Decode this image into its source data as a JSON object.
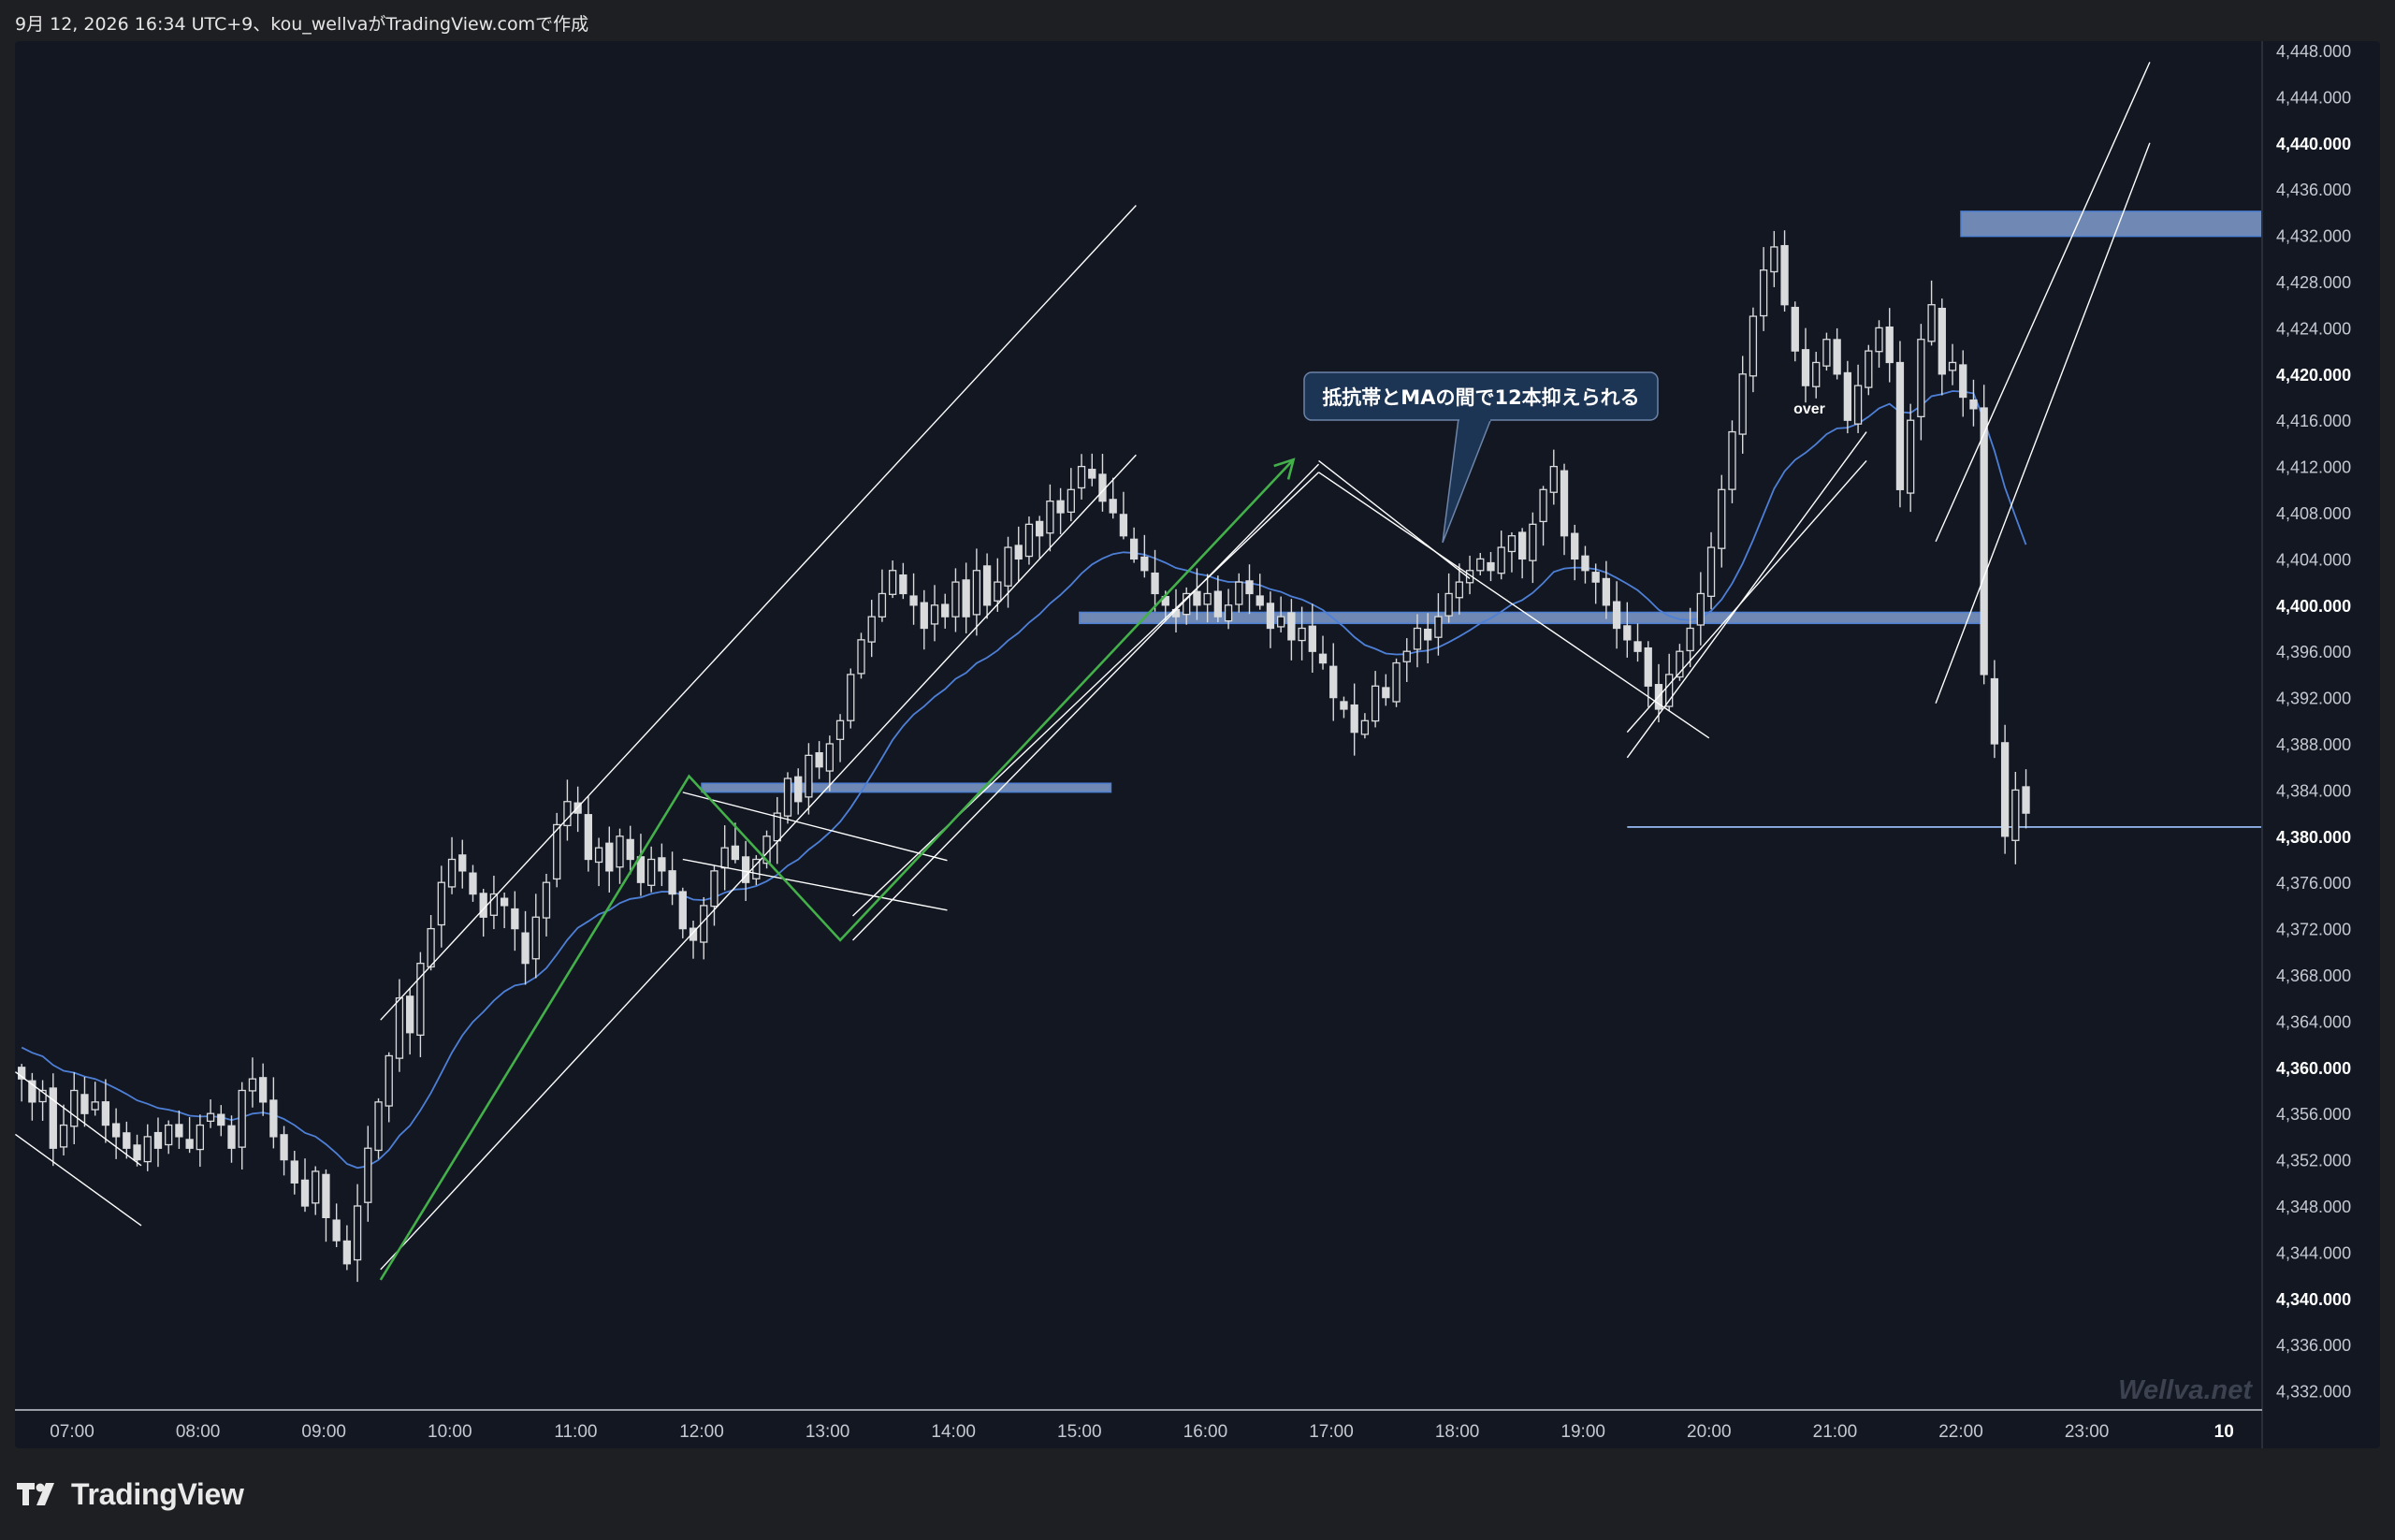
{
  "header": {
    "caption": "9月 12, 2026 16:34 UTC+9、kou_wellvaがTradingView.comで作成"
  },
  "footer": {
    "brand": "TradingView"
  },
  "watermark": "Wellva.net",
  "annotations": {
    "callout": "抵抗帯とMAの間で12本抑えられる",
    "over_label": "over"
  },
  "colors": {
    "background": "#121722",
    "candle": "#d9dadc",
    "ma": "#4e7fd6",
    "zone": "#8fb0e6",
    "trendline": "#ffffff",
    "arrow": "#43b04a"
  },
  "chart_data": {
    "type": "candlestick",
    "title": "",
    "xlabel": "",
    "ylabel": "",
    "ylim": [
      4330,
      4449
    ],
    "y_ticks": [
      {
        "value": 4448,
        "label": "4,448.000"
      },
      {
        "value": 4444,
        "label": "4,444.000"
      },
      {
        "value": 4440,
        "label": "4,440.000"
      },
      {
        "value": 4436,
        "label": "4,436.000"
      },
      {
        "value": 4432,
        "label": "4,432.000"
      },
      {
        "value": 4428,
        "label": "4,428.000"
      },
      {
        "value": 4424,
        "label": "4,424.000"
      },
      {
        "value": 4420,
        "label": "4,420.000"
      },
      {
        "value": 4416,
        "label": "4,416.000"
      },
      {
        "value": 4412,
        "label": "4,412.000"
      },
      {
        "value": 4408,
        "label": "4,408.000"
      },
      {
        "value": 4404,
        "label": "4,404.000"
      },
      {
        "value": 4400,
        "label": "4,400.000"
      },
      {
        "value": 4396,
        "label": "4,396.000"
      },
      {
        "value": 4392,
        "label": "4,392.000"
      },
      {
        "value": 4388,
        "label": "4,388.000"
      },
      {
        "value": 4384,
        "label": "4,384.000"
      },
      {
        "value": 4380,
        "label": "4,380.000"
      },
      {
        "value": 4376,
        "label": "4,376.000"
      },
      {
        "value": 4372,
        "label": "4,372.000"
      },
      {
        "value": 4368,
        "label": "4,368.000"
      },
      {
        "value": 4364,
        "label": "4,364.000"
      },
      {
        "value": 4360,
        "label": "4,360.000"
      },
      {
        "value": 4356,
        "label": "4,356.000"
      },
      {
        "value": 4352,
        "label": "4,352.000"
      },
      {
        "value": 4348,
        "label": "4,348.000"
      },
      {
        "value": 4344,
        "label": "4,344.000"
      },
      {
        "value": 4340,
        "label": "4,340.000"
      },
      {
        "value": 4336,
        "label": "4,336.000"
      },
      {
        "value": 4332,
        "label": "4,332.000"
      }
    ],
    "bold_ticks": [
      4440,
      4420,
      4400,
      4380,
      4360,
      4340
    ],
    "x_range": [
      6.55,
      24.5
    ],
    "x_ticks": [
      {
        "value": 7,
        "label": "07:00"
      },
      {
        "value": 8,
        "label": "08:00"
      },
      {
        "value": 9,
        "label": "09:00"
      },
      {
        "value": 10,
        "label": "10:00"
      },
      {
        "value": 11,
        "label": "11:00"
      },
      {
        "value": 12,
        "label": "12:00"
      },
      {
        "value": 13,
        "label": "13:00"
      },
      {
        "value": 14,
        "label": "14:00"
      },
      {
        "value": 15,
        "label": "15:00"
      },
      {
        "value": 16,
        "label": "16:00"
      },
      {
        "value": 17,
        "label": "17:00"
      },
      {
        "value": 18,
        "label": "18:00"
      },
      {
        "value": 19,
        "label": "19:00"
      },
      {
        "value": 20,
        "label": "20:00"
      },
      {
        "value": 21,
        "label": "21:00"
      },
      {
        "value": 22,
        "label": "22:00"
      },
      {
        "value": 23,
        "label": "23:00"
      },
      {
        "value": 24,
        "label": "10"
      }
    ],
    "grid": false,
    "legend": "none",
    "candle_interval_minutes": 5,
    "closes": [
      4359,
      4357,
      4358,
      4353,
      4355,
      4358,
      4356,
      4357,
      4355,
      4354,
      4353,
      4352,
      4354,
      4353,
      4355,
      4354,
      4353,
      4355,
      4356,
      4355,
      4353,
      4358,
      4359,
      4357,
      4354,
      4352,
      4350,
      4348,
      4351,
      4347,
      4345,
      4343,
      4348,
      4353,
      4357,
      4361,
      4366,
      4363,
      4369,
      4372,
      4376,
      4378,
      4377,
      4375,
      4373,
      4375,
      4374,
      4372,
      4369,
      4373,
      4376,
      4381,
      4383,
      4382,
      4378,
      4379,
      4377,
      4380,
      4378,
      4376,
      4378,
      4377,
      4375,
      4372,
      4371,
      4374,
      4377,
      4379,
      4378,
      4376,
      4378,
      4380,
      4382,
      4385,
      4383,
      4387,
      4386,
      4388,
      4390,
      4394,
      4397,
      4399,
      4401,
      4403,
      4401,
      4400,
      4398,
      4400,
      4399,
      4402,
      4399,
      4403,
      4400,
      4402,
      4405,
      4404,
      4407,
      4406,
      4409,
      4408,
      4410,
      4412,
      4411,
      4409,
      4408,
      4406,
      4404,
      4403,
      4401,
      4400,
      4399,
      4401,
      4400,
      4401,
      4399,
      4400,
      4402,
      4401,
      4400,
      4398,
      4399,
      4397,
      4398,
      4396,
      4395,
      4392,
      4391,
      4389,
      4390,
      4393,
      4392,
      4395,
      4396,
      4398,
      4397,
      4399,
      4401,
      4402,
      4403,
      4404,
      4403,
      4405,
      4406,
      4404,
      4407,
      4410,
      4412,
      4406,
      4404,
      4403,
      4402,
      4400,
      4398,
      4397,
      4396,
      4393,
      4391,
      4394,
      4396,
      4398,
      4401,
      4405,
      4410,
      4415,
      4420,
      4425,
      4429,
      4431,
      4426,
      4422,
      4419,
      4421,
      4423,
      4420,
      4416,
      4419,
      4422,
      4424,
      4421,
      4410,
      4416,
      4423,
      4426,
      4420,
      4421,
      4418,
      4417,
      4394,
      4388,
      4380,
      4384,
      4382
    ],
    "ma_label_free": true,
    "zones": [
      {
        "from_time": 12.0,
        "to_time": 15.25,
        "low": 4383.9,
        "high": 4384.5
      },
      {
        "from_time": 15.0,
        "to_time": 22.15,
        "low": 4398.5,
        "high": 4399.3
      },
      {
        "from_time": 22.0,
        "to_time": 24.5,
        "low": 4432.0,
        "high": 4434.0
      }
    ],
    "horizontal_lines": [
      {
        "from_time": 19.35,
        "to_time": 24.5,
        "value": 4380.8
      }
    ]
  }
}
